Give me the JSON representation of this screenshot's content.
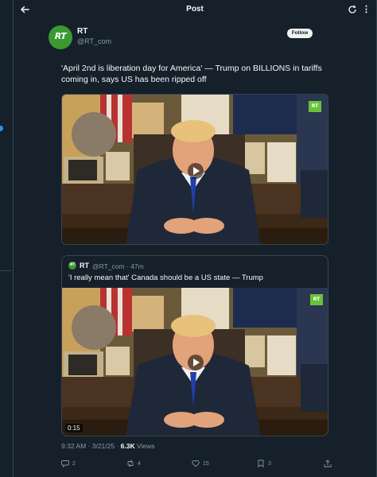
{
  "header": {
    "title": "Post"
  },
  "tweet": {
    "author_name": "RT",
    "author_handle": "@RT_com",
    "avatar_text": "RT",
    "follow_label": "Follow",
    "text": "'April 2nd is liberation day for America' — Trump on BILLIONS in tariffs coming in, says US has been ripped off",
    "media_badge": "RT"
  },
  "quote": {
    "avatar_text": "RT",
    "author_name": "RT",
    "handle_time": "@RT_com · 47m",
    "text": "'I really mean that' Canada should be a US state — Trump",
    "media_badge": "RT",
    "duration": "0:15"
  },
  "meta": {
    "time_date": "9:32 AM · 3/21/25 · ",
    "views_count": "6.3K",
    "views_label": " Views"
  },
  "actions": {
    "replies": "2",
    "reposts": "4",
    "likes": "15",
    "bookmarks": "3"
  },
  "colors": {
    "background": "#15202b",
    "border": "#38444d",
    "accent": "#1d9bf0",
    "secondary_text": "#8b98a5",
    "rt_green": "#6ac23a"
  }
}
